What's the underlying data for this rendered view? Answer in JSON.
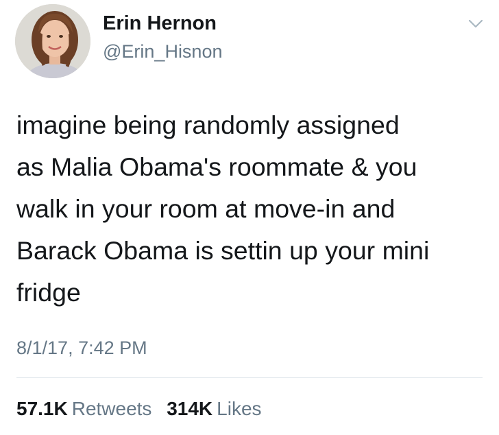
{
  "tweet": {
    "author": {
      "display_name": "Erin Hernon",
      "handle": "@Erin_Hisnon"
    },
    "text": "imagine being randomly assigned\nas Malia Obama's roommate & you\nwalk in your room at move-in and\nBarack Obama is settin up your mini\nfridge",
    "timestamp": "8/1/17, 7:42 PM",
    "stats": {
      "retweets_count": "57.1K",
      "retweets_label": "Retweets",
      "likes_count": "314K",
      "likes_label": "Likes"
    },
    "menu_icon": "chevron-down-icon"
  },
  "colors": {
    "primary_text": "#14171a",
    "secondary_text": "#657786",
    "divider": "#e1e8ed"
  }
}
